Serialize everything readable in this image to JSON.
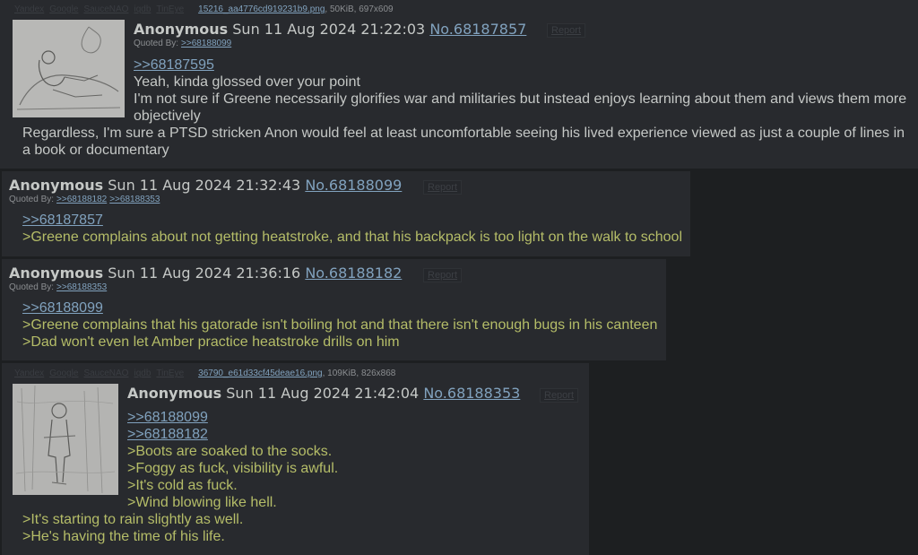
{
  "file_tools": [
    "Yandex",
    "Google",
    "SauceNAO",
    "iqdb",
    "TinEye"
  ],
  "posts": [
    {
      "file": {
        "name": "15216_aa4776cd919231b9.png",
        "meta": ", 50KiB, 697x609"
      },
      "name": "Anonymous",
      "date": "Sun 11 Aug 2024 21:22:03",
      "postno": "No.68187857",
      "report": "Report",
      "quoted_by_label": "Quoted By:",
      "quoted_by": [
        ">>68188099"
      ],
      "lines": [
        {
          "type": "link",
          "text": ">>68187595"
        },
        {
          "type": "text",
          "text": "Yeah, kinda glossed over your point"
        },
        {
          "type": "text",
          "text": "I'm not sure if Greene necessarily glorifies war and militaries but instead enjoys learning about them and views them more"
        },
        {
          "type": "text",
          "text": "objectively"
        },
        {
          "type": "text",
          "text": "Regardless, I'm sure a PTSD stricken Anon would feel at least uncomfortable seeing his lived experience viewed as just a couple of lines in"
        },
        {
          "type": "text",
          "text": "a book or documentary"
        }
      ]
    },
    {
      "name": "Anonymous",
      "date": "Sun 11 Aug 2024 21:32:43",
      "postno": "No.68188099",
      "report": "Report",
      "quoted_by_label": "Quoted By:",
      "quoted_by": [
        ">>68188182",
        ">>68188353"
      ],
      "lines": [
        {
          "type": "link",
          "text": ">>68187857"
        },
        {
          "type": "quote",
          "text": ">Greene complains about not getting heatstroke, and that his backpack is too light on the walk to school"
        }
      ]
    },
    {
      "name": "Anonymous",
      "date": "Sun 11 Aug 2024 21:36:16",
      "postno": "No.68188182",
      "report": "Report",
      "quoted_by_label": "Quoted By:",
      "quoted_by": [
        ">>68188353"
      ],
      "lines": [
        {
          "type": "link",
          "text": ">>68188099"
        },
        {
          "type": "quote",
          "text": ">Greene complains that his gatorade isn't boiling hot and that there isn't enough bugs in his canteen"
        },
        {
          "type": "quote",
          "text": ">Dad won't even let Amber practice heatstroke drills on him"
        }
      ]
    },
    {
      "file": {
        "name": "36790_e61d33cf45deae16.png",
        "meta": ", 109KiB, 826x868"
      },
      "name": "Anonymous",
      "date": "Sun 11 Aug 2024 21:42:04",
      "postno": "No.68188353",
      "report": "Report",
      "lines": [
        {
          "type": "link",
          "text": ">>68188099"
        },
        {
          "type": "link",
          "text": ">>68188182"
        },
        {
          "type": "quote",
          "text": ">Boots are soaked to the socks."
        },
        {
          "type": "quote",
          "text": ">Foggy as fuck, visibility is awful."
        },
        {
          "type": "quote",
          "text": ">It's cold as fuck."
        },
        {
          "type": "quote",
          "text": ">Wind blowing like hell."
        },
        {
          "type": "quote",
          "text": ">It's starting to rain slightly as well."
        },
        {
          "type": "quote",
          "text": ">He's having the time of his life."
        }
      ]
    }
  ],
  "colors": {
    "background": "#1d1f21",
    "post_bg": "#282a2e",
    "text": "#c5c8c6",
    "link": "#81a2be",
    "greentext": "#b5bd68"
  }
}
